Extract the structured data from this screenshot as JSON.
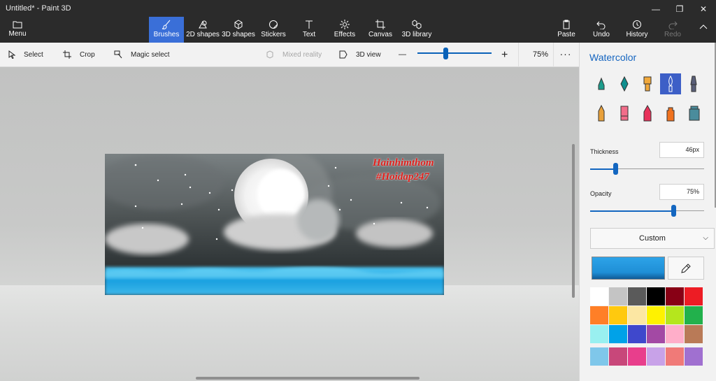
{
  "window": {
    "title": "Untitled* - Paint 3D",
    "controls": [
      "—",
      "❐",
      "✕"
    ]
  },
  "menu": {
    "label": "Menu"
  },
  "ribbon": {
    "tools": [
      {
        "label": "Brushes",
        "icon": "brush-icon",
        "active": true
      },
      {
        "label": "2D shapes",
        "icon": "2d-shapes-icon"
      },
      {
        "label": "3D shapes",
        "icon": "3d-shapes-icon"
      },
      {
        "label": "Stickers",
        "icon": "stickers-icon"
      },
      {
        "label": "Text",
        "icon": "text-icon"
      },
      {
        "label": "Effects",
        "icon": "effects-icon"
      },
      {
        "label": "Canvas",
        "icon": "canvas-icon"
      },
      {
        "label": "3D library",
        "icon": "3d-library-icon"
      }
    ],
    "actions": [
      {
        "label": "Paste",
        "icon": "paste-icon"
      },
      {
        "label": "Undo",
        "icon": "undo-icon"
      },
      {
        "label": "History",
        "icon": "history-icon"
      },
      {
        "label": "Redo",
        "icon": "redo-icon",
        "disabled": true
      }
    ],
    "collapse_icon": "chevron-up-icon"
  },
  "toolbar": {
    "select": "Select",
    "crop": "Crop",
    "magic_select": "Magic select",
    "mixed_reality": "Mixed reality",
    "view_3d": "3D view",
    "zoom_minus": "—",
    "zoom_plus": "+",
    "zoom_value": "75%",
    "zoom_level": 0.38,
    "more": "···"
  },
  "artwork": {
    "line1": "Hainhimthom",
    "line2": "#Hoidap247",
    "colors": {
      "sky": "#5b6164",
      "water": "#2fa8e0",
      "moon": "#f4f4f4"
    }
  },
  "panel": {
    "title": "Watercolor",
    "brushes": [
      {
        "name": "marker-brush-icon",
        "color": "#1d9c8c"
      },
      {
        "name": "calligraphy-pen-brush-icon",
        "color": "#0f8f8f"
      },
      {
        "name": "oil-brush-icon",
        "color": "#f2a93b"
      },
      {
        "name": "watercolor-brush-icon",
        "color": "#2f7bd6",
        "selected": true
      },
      {
        "name": "pixel-pen-brush-icon",
        "color": "#5a5f78"
      },
      {
        "name": "pencil-brush-icon",
        "color": "#e8a03a"
      },
      {
        "name": "eraser-brush-icon",
        "color": "#f26d8a"
      },
      {
        "name": "crayon-brush-icon",
        "color": "#e8325a"
      },
      {
        "name": "spray-can-brush-icon",
        "color": "#f0721e"
      },
      {
        "name": "fill-bucket-brush-icon",
        "color": "#4a8c9c"
      }
    ],
    "thickness": {
      "label": "Thickness",
      "value": "46px",
      "level": 0.22
    },
    "opacity": {
      "label": "Opacity",
      "value": "75%",
      "level": 0.73
    },
    "color_mode": "Custom",
    "current_color": "#1f8fd6",
    "eyedropper_icon": "eyedropper-icon",
    "palette": [
      "#ffffff",
      "#c4c4c4",
      "#5a5a5a",
      "#000000",
      "#880015",
      "#ed1c24",
      "#ff7f27",
      "#ffc90e",
      "#fce7a3",
      "#fff200",
      "#b5e61d",
      "#22b14c",
      "#99f0f0",
      "#00a2e8",
      "#3f48cc",
      "#a349a4",
      "#ffaec9",
      "#b97a57",
      "#7fc7ea",
      "#c8477a",
      "#e83e8c",
      "#c8a2e8",
      "#f07a78",
      "#a070d0"
    ]
  }
}
